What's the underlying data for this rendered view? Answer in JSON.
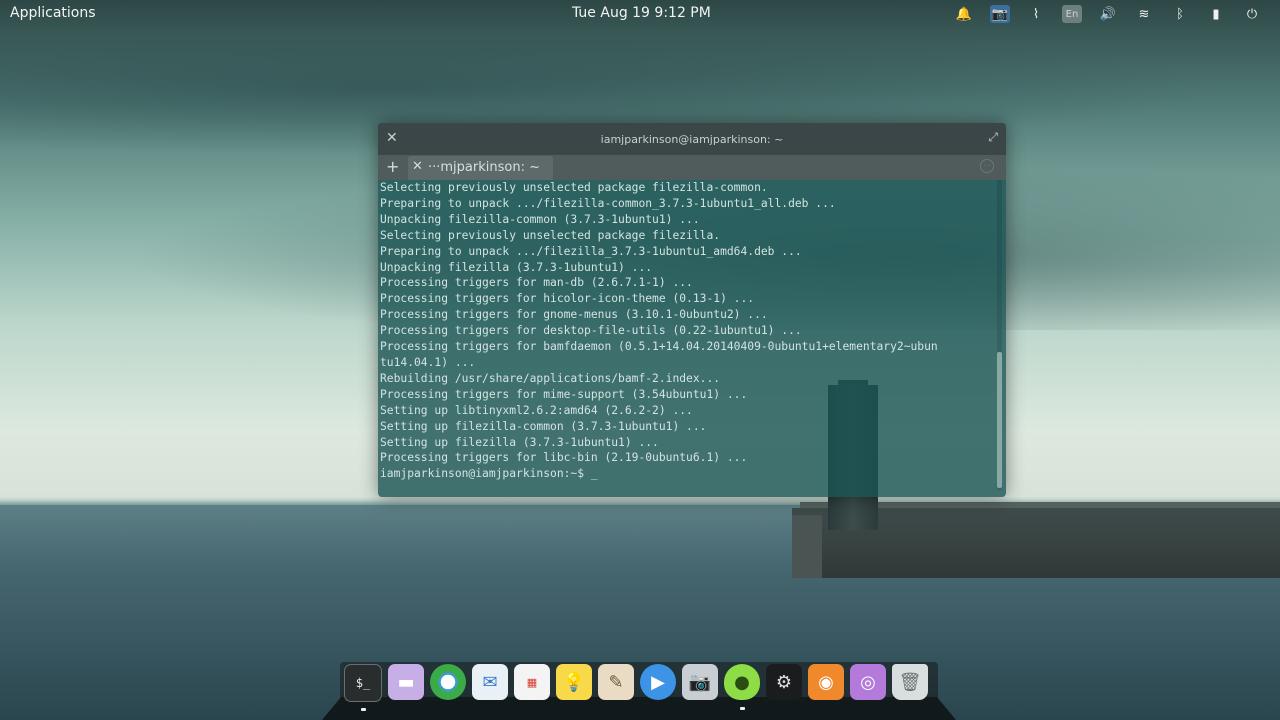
{
  "panel": {
    "applications_label": "Applications",
    "clock": "Tue Aug 19  9:12 PM",
    "indicators": [
      {
        "name": "bell-icon",
        "glyph": "🔔"
      },
      {
        "name": "camera-icon",
        "glyph": "📷"
      },
      {
        "name": "steam-icon",
        "glyph": "⌇"
      },
      {
        "name": "keyboard-layout-indicator",
        "glyph": "En"
      },
      {
        "name": "volume-icon",
        "glyph": "🔊"
      },
      {
        "name": "wifi-icon",
        "glyph": "≋"
      },
      {
        "name": "bluetooth-icon",
        "glyph": "ᛒ"
      },
      {
        "name": "battery-icon",
        "glyph": "▮"
      },
      {
        "name": "power-icon",
        "glyph": "⏻"
      }
    ]
  },
  "terminal": {
    "window_title": "iamjparkinson@iamjparkinson: ~",
    "tab_label": "···mjparkinson: ~",
    "lines": [
      "Selecting previously unselected package filezilla-common.",
      "Preparing to unpack .../filezilla-common_3.7.3-1ubuntu1_all.deb ...",
      "Unpacking filezilla-common (3.7.3-1ubuntu1) ...",
      "Selecting previously unselected package filezilla.",
      "Preparing to unpack .../filezilla_3.7.3-1ubuntu1_amd64.deb ...",
      "Unpacking filezilla (3.7.3-1ubuntu1) ...",
      "Processing triggers for man-db (2.6.7.1-1) ...",
      "Processing triggers for hicolor-icon-theme (0.13-1) ...",
      "Processing triggers for gnome-menus (3.10.1-0ubuntu2) ...",
      "Processing triggers for desktop-file-utils (0.22-1ubuntu1) ...",
      "Processing triggers for bamfdaemon (0.5.1+14.04.20140409-0ubuntu1+elementary2~ubun",
      "tu14.04.1) ...",
      "Rebuilding /usr/share/applications/bamf-2.index...",
      "Processing triggers for mime-support (3.54ubuntu1) ...",
      "Setting up libtinyxml2.6.2:amd64 (2.6.2-2) ...",
      "Setting up filezilla-common (3.7.3-1ubuntu1) ...",
      "Setting up filezilla (3.7.3-1ubuntu1) ...",
      "Processing triggers for libc-bin (2.19-0ubuntu6.1) ...",
      "iamjparkinson@iamjparkinson:~$ _"
    ]
  },
  "dock": {
    "items": [
      {
        "name": "dock-terminal",
        "glyph": "$_",
        "cls": "di-term",
        "running": true
      },
      {
        "name": "dock-files",
        "glyph": "▬",
        "cls": "di-files",
        "running": false
      },
      {
        "name": "dock-chrome",
        "glyph": "",
        "cls": "di-chrome",
        "running": false
      },
      {
        "name": "dock-mail",
        "glyph": "✉",
        "cls": "di-mail",
        "running": false
      },
      {
        "name": "dock-calendar",
        "glyph": "▦",
        "cls": "di-cal",
        "running": false
      },
      {
        "name": "dock-notes",
        "glyph": "💡",
        "cls": "di-note",
        "running": false
      },
      {
        "name": "dock-writer",
        "glyph": "✎",
        "cls": "di-write",
        "running": false
      },
      {
        "name": "dock-video",
        "glyph": "▶",
        "cls": "di-video",
        "running": false
      },
      {
        "name": "dock-screenshot",
        "glyph": "📷",
        "cls": "di-shot",
        "running": false
      },
      {
        "name": "dock-feedreader",
        "glyph": "●",
        "cls": "di-bird",
        "running": true
      },
      {
        "name": "dock-steam",
        "glyph": "⚙",
        "cls": "di-steam",
        "running": false
      },
      {
        "name": "dock-rss",
        "glyph": "◉",
        "cls": "di-rss",
        "running": false
      },
      {
        "name": "dock-podcast",
        "glyph": "◎",
        "cls": "di-pod",
        "running": false
      },
      {
        "name": "dock-trash",
        "glyph": "🗑",
        "cls": "di-trash",
        "running": false
      }
    ]
  }
}
